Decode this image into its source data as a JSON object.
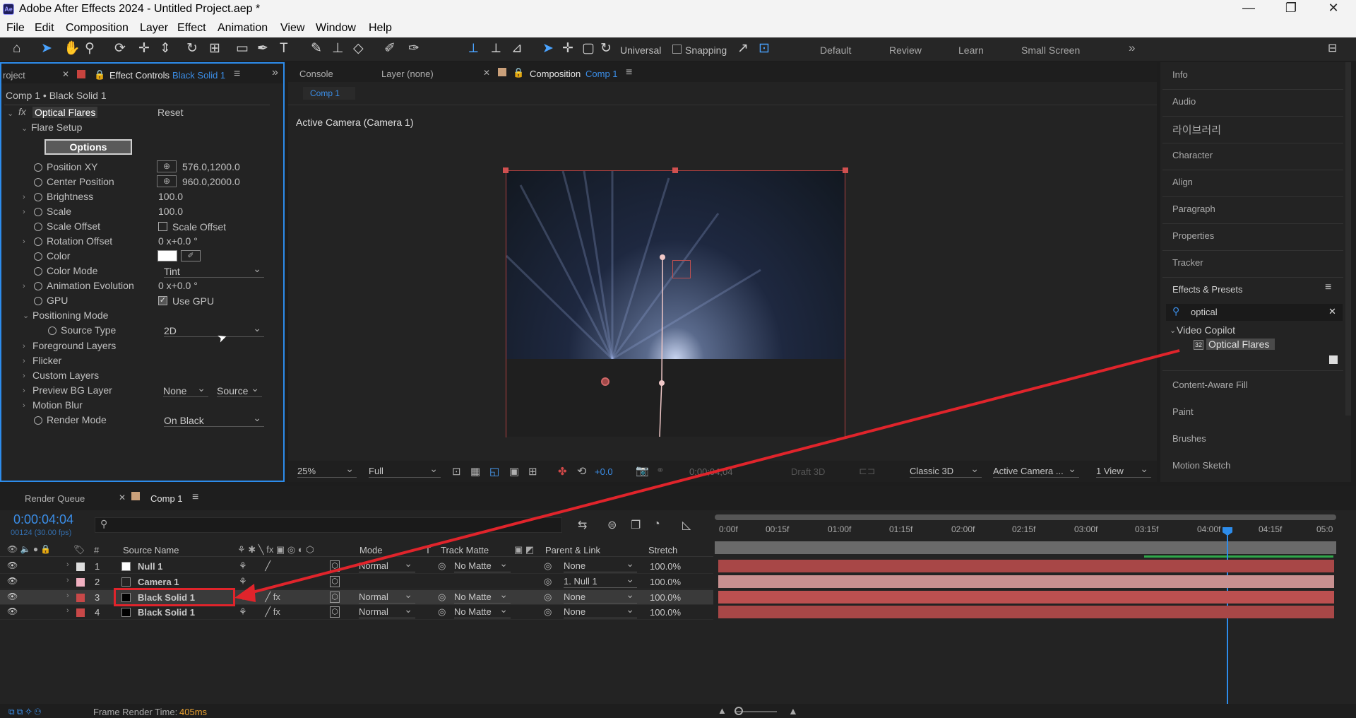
{
  "window": {
    "app_icon": "Ae",
    "title": "Adobe After Effects 2024 - Untitled Project.aep *"
  },
  "menu": [
    "File",
    "Edit",
    "Composition",
    "Layer",
    "Effect",
    "Animation",
    "View",
    "Window",
    "Help"
  ],
  "toolbar": {
    "universal_label": "Universal",
    "snapping_label": "Snapping",
    "workspaces": [
      "Default",
      "Review",
      "Learn",
      "Small Screen"
    ]
  },
  "left_panel": {
    "tab_project": "roject",
    "tab_effect_controls": "Effect Controls",
    "tab_effect_layer": "Black Solid 1",
    "header": "Comp 1 • Black Solid 1",
    "effect_name": "Optical Flares",
    "reset": "Reset",
    "flare_setup": "Flare Setup",
    "options_button": "Options",
    "properties": [
      {
        "label": "Position XY",
        "value": "576.0,1200.0"
      },
      {
        "label": "Center Position",
        "value": "960.0,2000.0"
      },
      {
        "label": "Brightness",
        "value": "100.0"
      },
      {
        "label": "Scale",
        "value": "100.0"
      },
      {
        "label": "Scale Offset",
        "value": "Scale Offset"
      },
      {
        "label": "Rotation Offset",
        "value": "0 x+0.0 °"
      },
      {
        "label": "Color",
        "value": ""
      },
      {
        "label": "Color Mode",
        "value": "Tint"
      },
      {
        "label": "Animation Evolution",
        "value": "0 x+0.0 °"
      },
      {
        "label": "GPU",
        "value": "Use GPU"
      },
      {
        "label": "Positioning Mode",
        "value": ""
      },
      {
        "label": "Source Type",
        "value": "2D"
      },
      {
        "label": "Foreground Layers",
        "value": ""
      },
      {
        "label": "Flicker",
        "value": ""
      },
      {
        "label": "Custom Layers",
        "value": ""
      },
      {
        "label": "Preview BG Layer",
        "value": "None"
      },
      {
        "label": "Motion Blur",
        "value": ""
      },
      {
        "label": "Render Mode",
        "value": "On Black"
      }
    ],
    "preview_bg_source": "Source"
  },
  "comp_panel": {
    "tab_console": "Console",
    "tab_layer": "Layer (none)",
    "tab_composition": "Composition",
    "tab_comp_name": "Comp 1",
    "breadcrumb": "Comp 1",
    "camera_label": "Active Camera (Camera 1)",
    "zoom": "25%",
    "resolution": "Full",
    "exposure": "+0.0",
    "timecode": "0;00;04;04",
    "draft3d": "Draft 3D",
    "renderer": "Classic 3D",
    "camera_view": "Active Camera ...",
    "views": "1 View"
  },
  "right_panel": {
    "items": [
      "Info",
      "Audio",
      "라이브러리",
      "Character",
      "Align",
      "Paragraph",
      "Properties",
      "Tracker"
    ],
    "effects_presets": "Effects & Presets",
    "search_value": "optical",
    "category": "Video Copilot",
    "effect": "Optical Flares",
    "effect_badge": "32",
    "lower_items": [
      "Content-Aware Fill",
      "Paint",
      "Brushes",
      "Motion Sketch"
    ]
  },
  "timeline": {
    "tab_render_queue": "Render Queue",
    "tab_comp": "Comp 1",
    "timecode": "0:00:04:04",
    "fps": "00124 (30.00 fps)",
    "columns": {
      "source_name": "Source Name",
      "mode": "Mode",
      "t": "T",
      "track_matte": "Track Matte",
      "parent": "Parent & Link",
      "stretch": "Stretch"
    },
    "ruler": [
      "0:00f",
      "00:15f",
      "01:00f",
      "01:15f",
      "02:00f",
      "02:15f",
      "03:00f",
      "03:15f",
      "04:00f",
      "04:15f",
      "05:0"
    ],
    "layers": [
      {
        "num": "1",
        "name": "Null 1",
        "mode": "Normal",
        "matte": "No Matte",
        "parent": "None",
        "stretch": "100.0%"
      },
      {
        "num": "2",
        "name": "Camera 1",
        "mode": "",
        "matte": "",
        "parent": "1. Null 1",
        "stretch": "100.0%"
      },
      {
        "num": "3",
        "name": "Black Solid 1",
        "mode": "Normal",
        "matte": "No Matte",
        "parent": "None",
        "stretch": "100.0%"
      },
      {
        "num": "4",
        "name": "Black Solid 1",
        "mode": "Normal",
        "matte": "No Matte",
        "parent": "None",
        "stretch": "100.0%"
      }
    ],
    "frame_render_label": "Frame Render Time:",
    "frame_render_value": "405ms"
  },
  "colors": {
    "accent": "#2d8ceb",
    "annotation": "#e0242b",
    "layer_bar": "#a84747"
  }
}
